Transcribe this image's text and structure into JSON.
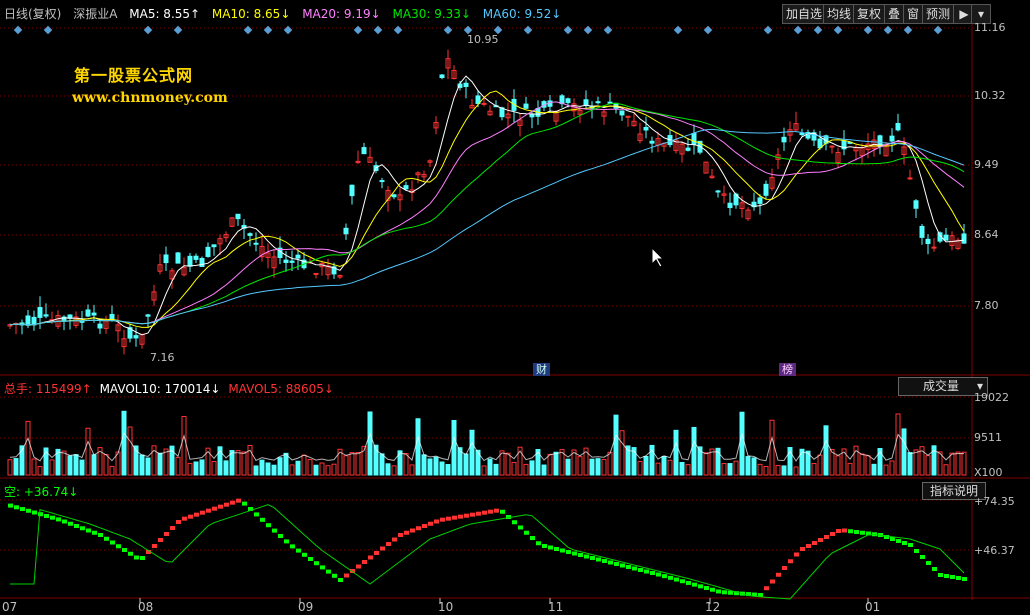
{
  "header": {
    "period": "日线(复权)",
    "stock_name": "深振业A",
    "ma5": "MA5: 8.55↑",
    "ma10": "MA10: 8.65↓",
    "ma20": "MA20: 9.19↓",
    "ma30": "MA30: 9.33↓",
    "ma60": "MA60: 9.52↓"
  },
  "toolbar": {
    "add_watch": "加自选",
    "ma_line": "均线",
    "adjust": "复权",
    "overlay": "叠",
    "window": "窗",
    "forecast": "预测"
  },
  "watermark": {
    "name": "第一股票公式网",
    "url": "www.chnmoney.com"
  },
  "price_axis": [
    "11.16",
    "10.32",
    "9.49",
    "8.64",
    "7.80"
  ],
  "annotations": {
    "high": "10.95",
    "low": "7.16"
  },
  "event_badges": {
    "finance": "财",
    "ranking": "榜"
  },
  "volume_panel": {
    "total": "总手: 115499↑",
    "mavol10": "MAVOL10: 170014↓",
    "mavol5": "MAVOL5: 88605↓",
    "selector": "成交量",
    "axis": [
      "19022",
      "9511",
      "X100"
    ]
  },
  "indicator_panel": {
    "label": "空: +36.74↓",
    "button": "指标说明",
    "axis": [
      "+74.35",
      "+46.37"
    ]
  },
  "months": [
    "07",
    "08",
    "09",
    "10",
    "11",
    "12",
    "01"
  ],
  "colors": {
    "up": "#ff3232",
    "down": "#54ffff",
    "ma5": "#ffffff",
    "ma10": "#ffff00",
    "ma20": "#ff80ff",
    "ma30": "#00e600",
    "ma60": "#54c8ff",
    "grid": "#800000"
  }
}
